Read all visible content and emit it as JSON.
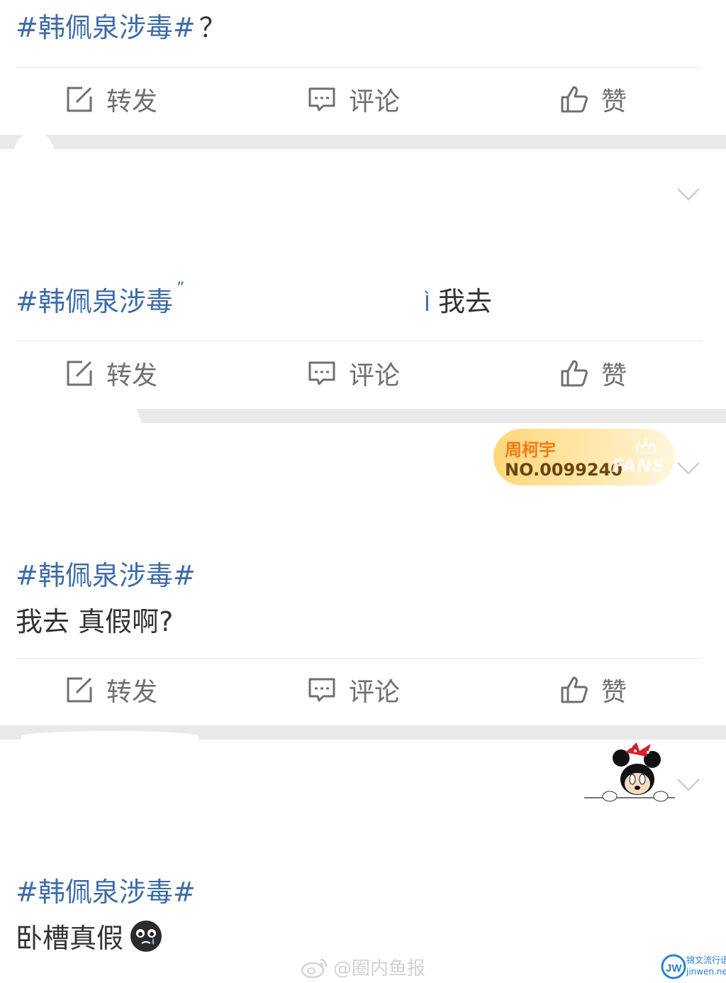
{
  "posts": [
    {
      "topic": "#韩佩泉涉毒#",
      "text": "？",
      "actions": {
        "repost": "转发",
        "comment": "评论",
        "like": "赞"
      }
    },
    {
      "topic": "#韩佩泉涉毒",
      "middle": "",
      "tail_fragment": "Ì",
      "text": "我去",
      "actions": {
        "repost": "转发",
        "comment": "评论",
        "like": "赞"
      }
    },
    {
      "badge": {
        "name": "周柯宇",
        "number": "NO.0099240",
        "label": "FANS"
      },
      "topic": "#韩佩泉涉毒#",
      "text": "我去 真假啊?",
      "actions": {
        "repost": "转发",
        "comment": "评论",
        "like": "赞"
      }
    },
    {
      "topic": "#韩佩泉涉毒#",
      "text": "卧槽真假",
      "emoji": "crying-face-icon"
    }
  ],
  "watermark": {
    "text": "@圈内鱼报",
    "icon": "weibo-icon"
  },
  "site": {
    "name": "锦文流行语",
    "url": "jinwen.net",
    "logo": "jw"
  },
  "colors": {
    "topic": "#3e6ca8",
    "text": "#333333",
    "action": "#6f6f6f",
    "gap": "#e9e9e9"
  }
}
